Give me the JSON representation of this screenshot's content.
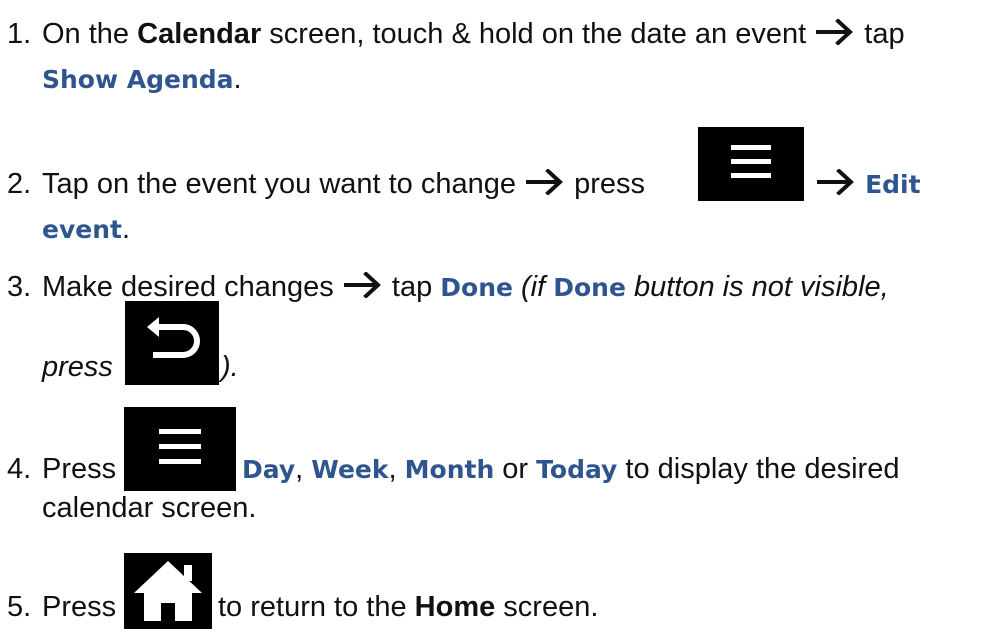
{
  "steps": [
    {
      "number": "1.",
      "text1": "On the ",
      "bold1": "Calendar",
      "text2": " screen, touch & hold on the date an event ",
      "text3": " tap",
      "keyword1": "Show Agenda",
      "end": "."
    },
    {
      "number": "2.",
      "text1": "Tap on the event you want to change ",
      "text2": " press",
      "keyword1_line1": "Edit",
      "keyword1_line2": "event",
      "end": "."
    },
    {
      "number": "3.",
      "text1": "Make desired changes ",
      "text2": " tap ",
      "keyword1": "Done",
      "italic1": " (if ",
      "keyword2": "Done",
      "italic2": " button is not visible,",
      "italic3": "press ",
      "end": ")."
    },
    {
      "number": "4.",
      "text1": "Press ",
      "keyword_day": "Day",
      "comma1": ", ",
      "keyword_week": "Week",
      "comma2": ", ",
      "keyword_month": "Month",
      "or": " or ",
      "keyword_today": "Today",
      "text2": " to display the desired",
      "text3": "calendar screen."
    },
    {
      "number": "5.",
      "text1": "Press ",
      "text2": " to return to the ",
      "bold1": "Home",
      "text3": " screen."
    }
  ],
  "icons": {
    "menu": "menu-icon",
    "back": "back-icon",
    "home": "home-icon",
    "arrow": "right-arrow-icon"
  },
  "colors": {
    "keyword": "#2f5590",
    "text": "#111111",
    "icon_bg": "#000000",
    "icon_fg": "#ffffff"
  }
}
